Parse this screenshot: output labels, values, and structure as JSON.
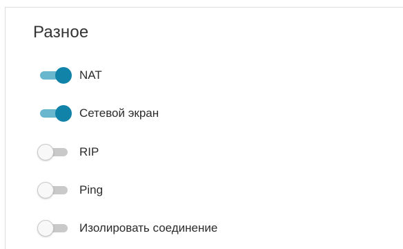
{
  "section": {
    "title": "Разное"
  },
  "toggles": [
    {
      "label": "NAT",
      "state": "on"
    },
    {
      "label": "Сетевой экран",
      "state": "on"
    },
    {
      "label": "RIP",
      "state": "off"
    },
    {
      "label": "Ping",
      "state": "off"
    },
    {
      "label": "Изолировать соединение",
      "state": "off"
    }
  ],
  "colors": {
    "toggle_on_knob": "#1283a8",
    "toggle_on_track": "#69b6cf",
    "toggle_off_track": "#c9c9c9",
    "toggle_off_knob": "#f8f8f8"
  }
}
